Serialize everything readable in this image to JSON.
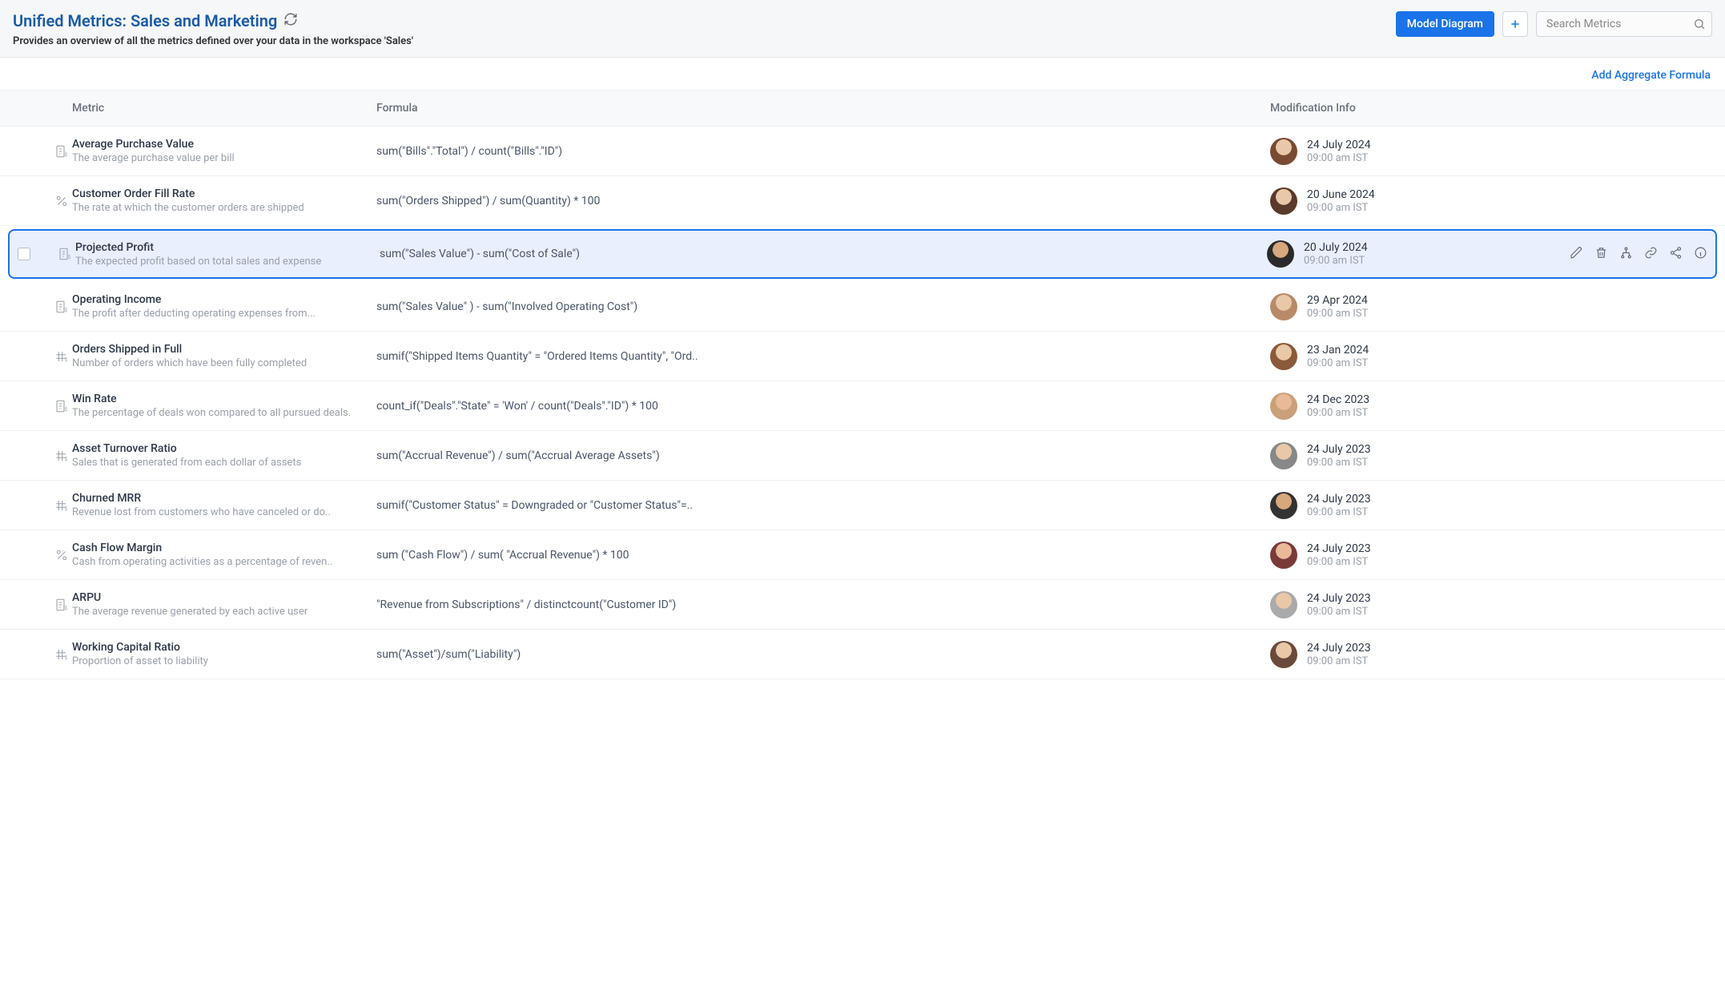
{
  "header": {
    "title": "Unified Metrics: Sales and Marketing",
    "subtitle": "Provides an overview of all the metrics defined over your data in the workspace 'Sales'",
    "model_diagram_label": "Model Diagram",
    "search_placeholder": "Search Metrics"
  },
  "toolbar": {
    "add_formula_label": "Add Aggregate Formula"
  },
  "columns": {
    "metric": "Metric",
    "formula": "Formula",
    "modification": "Modification Info"
  },
  "rows": [
    {
      "icon": "currency",
      "name": "Average Purchase Value",
      "desc": "The average purchase value per bill",
      "formula": "sum(\"Bills\".\"Total\") / count(\"Bills\".\"ID\")",
      "date": "24 July 2024",
      "time": "09:00 am IST",
      "avatar": "av0",
      "selected": false
    },
    {
      "icon": "percent",
      "name": "Customer Order Fill Rate",
      "desc": "The rate at which the customer orders are shipped",
      "formula": "sum(\"Orders Shipped\") / sum(Quantity) * 100",
      "date": "20 June 2024",
      "time": "09:00 am IST",
      "avatar": "av1",
      "selected": false
    },
    {
      "icon": "currency",
      "name": "Projected Profit",
      "desc": "The expected profit based on total sales and expense",
      "formula": "sum(\"Sales Value\") - sum(\"Cost of Sale\")",
      "date": "20 July 2024",
      "time": "09:00 am IST",
      "avatar": "av2",
      "selected": true
    },
    {
      "icon": "currency",
      "name": "Operating Income",
      "desc": "The profit after deducting operating expenses from...",
      "formula": "sum(\"Sales Value\" ) - sum(\"Involved Operating Cost\")",
      "date": "29 Apr 2024",
      "time": "09:00 am IST",
      "avatar": "av3",
      "selected": false
    },
    {
      "icon": "hash",
      "name": "Orders Shipped in Full",
      "desc": "Number of orders which have been fully completed",
      "formula": "sumif(\"Shipped Items Quantity\" = \"Ordered Items Quantity\", \"Ord..",
      "date": "23 Jan 2024",
      "time": "09:00 am IST",
      "avatar": "av4",
      "selected": false
    },
    {
      "icon": "currency",
      "name": "Win Rate",
      "desc": "The percentage of deals won compared to all pursued deals.",
      "formula": "count_if(\"Deals\".\"State\" = 'Won' / count(\"Deals\".\"ID\") * 100",
      "date": "24 Dec 2023",
      "time": "09:00 am IST",
      "avatar": "av5",
      "selected": false
    },
    {
      "icon": "hash",
      "name": "Asset Turnover Ratio",
      "desc": "Sales that is generated from each dollar of assets",
      "formula": "sum(\"Accrual Revenue\") / sum(\"Accrual Average Assets\")",
      "date": "24 July 2023",
      "time": "09:00 am IST",
      "avatar": "av6",
      "selected": false
    },
    {
      "icon": "hash",
      "name": "Churned MRR",
      "desc": "Revenue lost from customers who have canceled or do..",
      "formula": "sumif(\"Customer Status\" = Downgraded or \"Customer Status\"=..",
      "date": "24 July 2023",
      "time": "09:00 am IST",
      "avatar": "av7",
      "selected": false
    },
    {
      "icon": "percent",
      "name": "Cash Flow Margin",
      "desc": "Cash from operating activities as a percentage of reven..",
      "formula": "sum (\"Cash Flow\") / sum( \"Accrual Revenue\") * 100",
      "date": "24 July 2023",
      "time": "09:00 am IST",
      "avatar": "av8",
      "selected": false
    },
    {
      "icon": "currency",
      "name": "ARPU",
      "desc": "The average revenue generated by each active user",
      "formula": "\"Revenue from Subscriptions\" / distinctcount(\"Customer ID\")",
      "date": "24 July 2023",
      "time": "09:00 am IST",
      "avatar": "av9",
      "selected": false
    },
    {
      "icon": "hash",
      "name": "Working Capital Ratio",
      "desc": "Proportion of asset to liability",
      "formula": "sum(\"Asset\")/sum(\"Liability\")",
      "date": "24 July 2023",
      "time": "09:00 am IST",
      "avatar": "av10",
      "selected": false
    }
  ]
}
